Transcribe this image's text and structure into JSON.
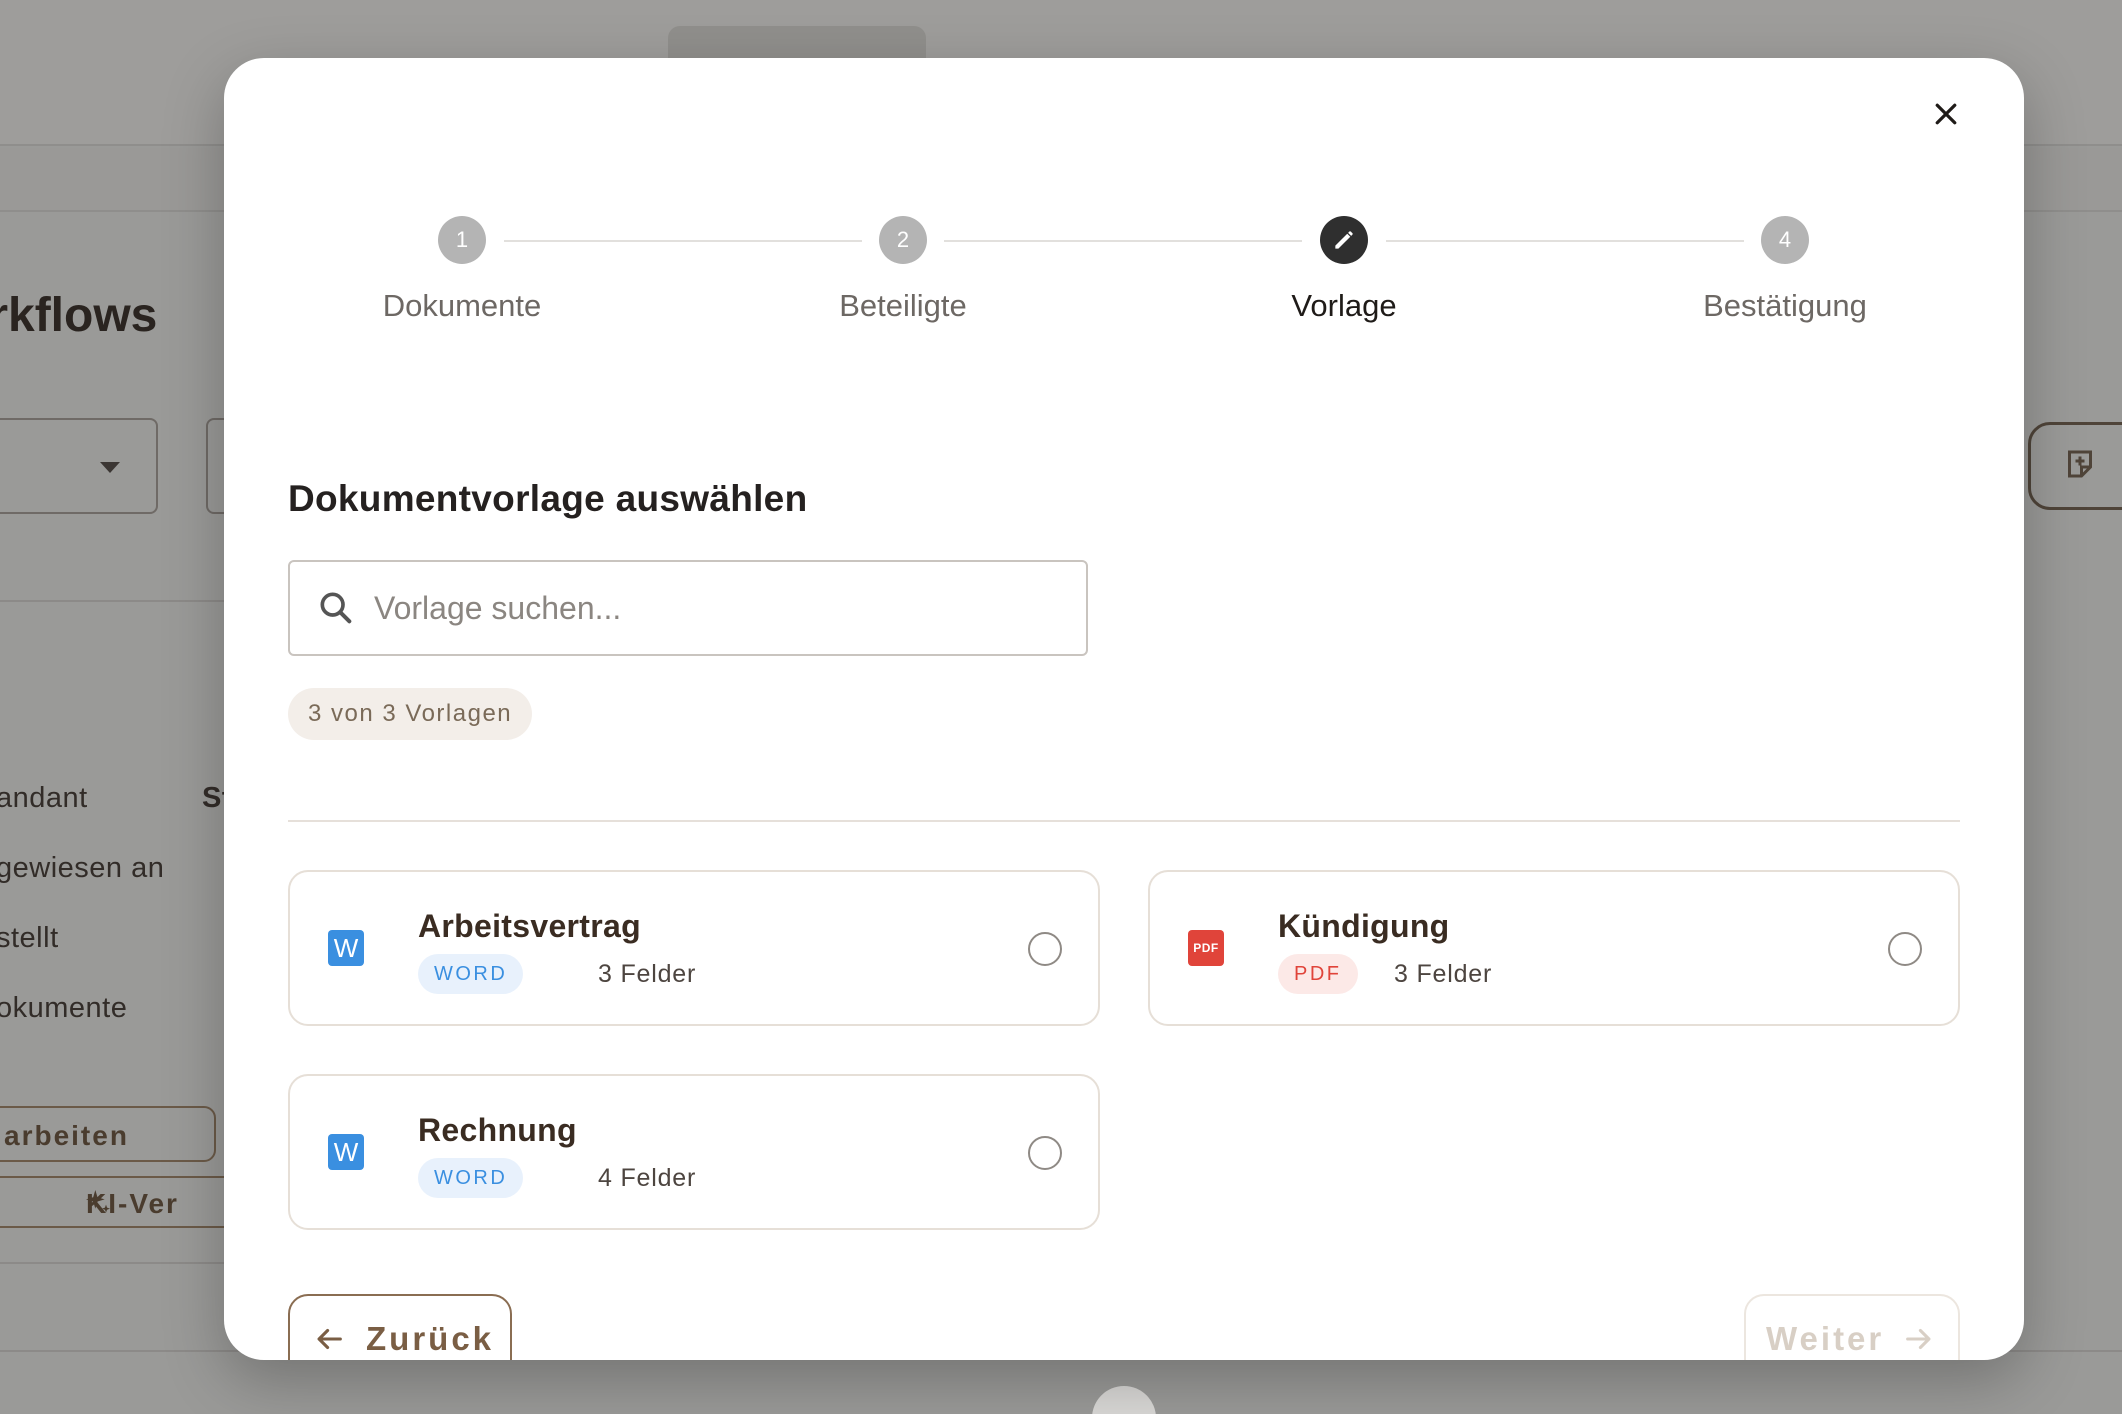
{
  "background": {
    "page_title": "orkflows",
    "filter_labels": [
      "andant",
      "gewiesen an",
      "stellt",
      "okumente"
    ],
    "filter_label_extra": "St",
    "edit_button": "arbeiten",
    "ai_button": "KI-Ver"
  },
  "modal": {
    "steps": [
      {
        "number": "1",
        "label": "Dokumente",
        "state": "done"
      },
      {
        "number": "2",
        "label": "Beteiligte",
        "state": "done"
      },
      {
        "number": "",
        "label": "Vorlage",
        "state": "active",
        "icon": "pencil-icon"
      },
      {
        "number": "4",
        "label": "Bestätigung",
        "state": "pending"
      }
    ],
    "section_title": "Dokumentvorlage auswählen",
    "search": {
      "placeholder": "Vorlage suchen...",
      "value": ""
    },
    "count_chip": "3 von 3 Vorlagen",
    "templates": [
      {
        "name": "Arbeitsvertrag",
        "type": "WORD",
        "icon_text": "W",
        "fields": "3 Felder",
        "selected": false
      },
      {
        "name": "Kündigung",
        "type": "PDF",
        "icon_text": "PDF",
        "fields": "3 Felder",
        "selected": false
      },
      {
        "name": "Rechnung",
        "type": "WORD",
        "icon_text": "W",
        "fields": "4 Felder",
        "selected": false
      }
    ],
    "back_button": "Zurück",
    "next_button": "Weiter"
  },
  "colors": {
    "word": "#3a8fe0",
    "pdf": "#e0443a",
    "active_step": "#2f2f2f",
    "inactive_step": "#b4b4b4",
    "accent_brown": "#7a5e44"
  }
}
